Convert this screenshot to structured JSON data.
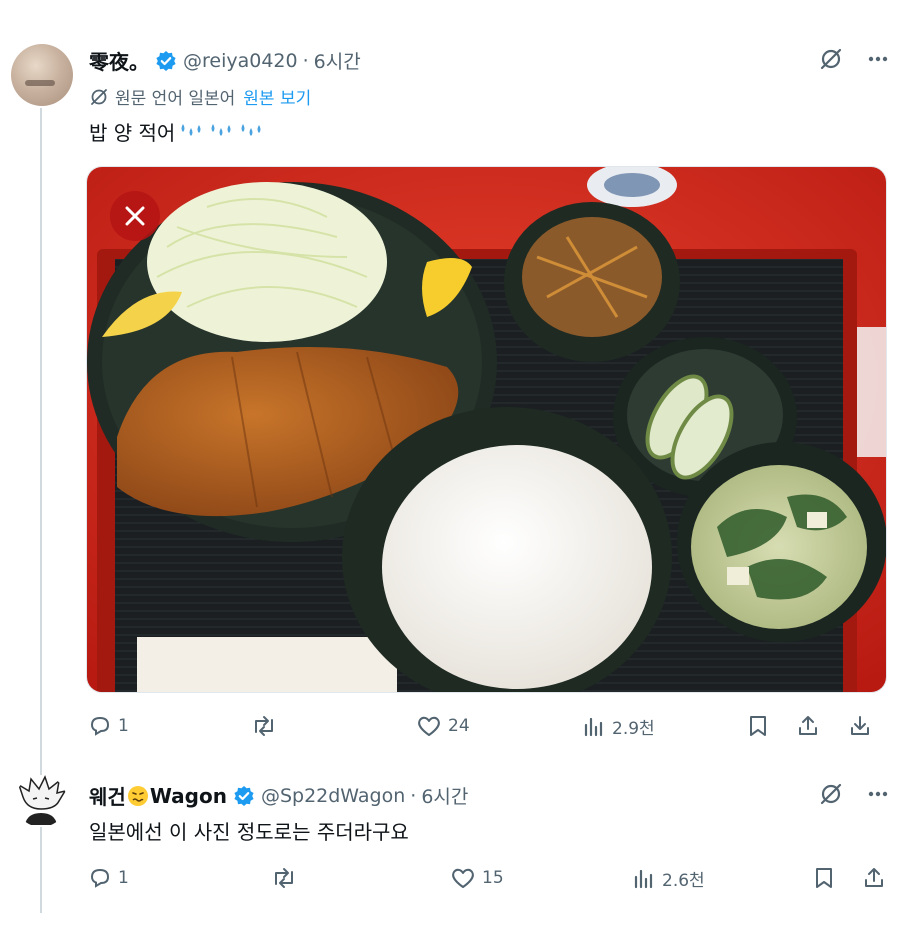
{
  "tweet1": {
    "display_name": "零夜。",
    "handle": "@reiya0420",
    "separator": "·",
    "time": "6시간",
    "translate_prefix": "원문 언어 일본어",
    "translate_link": "원본 보기",
    "text": "밥 양 적어",
    "emoji_icons": [
      "sweat-drops-icon",
      "sweat-drops-icon",
      "sweat-drops-icon"
    ],
    "media_description": "photo",
    "stats": {
      "replies": "1",
      "retweets": "",
      "likes": "24",
      "views": "2.9천"
    }
  },
  "tweet2": {
    "display_name_prefix": "웨건",
    "display_name_suffix": "Wagon",
    "handle": "@Sp22dWagon",
    "separator": "·",
    "time": "6시간",
    "text": "일본에선 이 사진 정도로는 주더라구요",
    "stats": {
      "replies": "1",
      "retweets": "",
      "likes": "15",
      "views": "2.6천"
    }
  },
  "colors": {
    "accent": "#1d9bf0",
    "muted": "#536471",
    "text": "#0f1419",
    "tray_red": "#d7271a"
  }
}
